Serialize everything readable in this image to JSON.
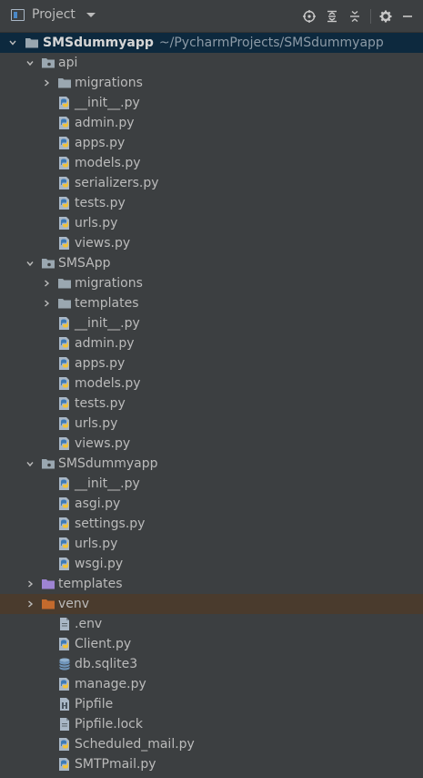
{
  "header": {
    "title": "Project"
  },
  "root": {
    "name": "SMSdummyapp",
    "path": "~/PycharmProjects/SMSdummyapp"
  },
  "tree": [
    {
      "name": "api",
      "depth": 1,
      "kind": "pkg",
      "expanded": true
    },
    {
      "name": "migrations",
      "depth": 2,
      "kind": "folder",
      "expanded": false
    },
    {
      "name": "__init__.py",
      "depth": 3,
      "kind": "py"
    },
    {
      "name": "admin.py",
      "depth": 3,
      "kind": "py"
    },
    {
      "name": "apps.py",
      "depth": 3,
      "kind": "py"
    },
    {
      "name": "models.py",
      "depth": 3,
      "kind": "py"
    },
    {
      "name": "serializers.py",
      "depth": 3,
      "kind": "py"
    },
    {
      "name": "tests.py",
      "depth": 3,
      "kind": "py"
    },
    {
      "name": "urls.py",
      "depth": 3,
      "kind": "py"
    },
    {
      "name": "views.py",
      "depth": 3,
      "kind": "py"
    },
    {
      "name": "SMSApp",
      "depth": 1,
      "kind": "pkg",
      "expanded": true
    },
    {
      "name": "migrations",
      "depth": 2,
      "kind": "folder",
      "expanded": false
    },
    {
      "name": "templates",
      "depth": 2,
      "kind": "folder",
      "expanded": false
    },
    {
      "name": "__init__.py",
      "depth": 3,
      "kind": "py"
    },
    {
      "name": "admin.py",
      "depth": 3,
      "kind": "py"
    },
    {
      "name": "apps.py",
      "depth": 3,
      "kind": "py"
    },
    {
      "name": "models.py",
      "depth": 3,
      "kind": "py"
    },
    {
      "name": "tests.py",
      "depth": 3,
      "kind": "py"
    },
    {
      "name": "urls.py",
      "depth": 3,
      "kind": "py"
    },
    {
      "name": "views.py",
      "depth": 3,
      "kind": "py"
    },
    {
      "name": "SMSdummyapp",
      "depth": 1,
      "kind": "pkg",
      "expanded": true
    },
    {
      "name": "__init__.py",
      "depth": 3,
      "kind": "py"
    },
    {
      "name": "asgi.py",
      "depth": 3,
      "kind": "py"
    },
    {
      "name": "settings.py",
      "depth": 3,
      "kind": "py"
    },
    {
      "name": "urls.py",
      "depth": 3,
      "kind": "py"
    },
    {
      "name": "wsgi.py",
      "depth": 3,
      "kind": "py"
    },
    {
      "name": "templates",
      "depth": 1,
      "kind": "templates",
      "expanded": false
    },
    {
      "name": "venv",
      "depth": 1,
      "kind": "venv",
      "expanded": false
    },
    {
      "name": ".env",
      "depth": 2,
      "kind": "file"
    },
    {
      "name": "Client.py",
      "depth": 2,
      "kind": "py"
    },
    {
      "name": "db.sqlite3",
      "depth": 2,
      "kind": "db"
    },
    {
      "name": "manage.py",
      "depth": 2,
      "kind": "py"
    },
    {
      "name": "Pipfile",
      "depth": 2,
      "kind": "pipfile"
    },
    {
      "name": "Pipfile.lock",
      "depth": 2,
      "kind": "file"
    },
    {
      "name": "Scheduled_mail.py",
      "depth": 2,
      "kind": "py"
    },
    {
      "name": "SMTPmail.py",
      "depth": 2,
      "kind": "py"
    }
  ],
  "colors": {
    "background": "#3c3f41",
    "selected_row": "#0d293e",
    "venv_row": "#4a3b2d",
    "text": "#bbbbbb",
    "path_text": "#8c9aa6"
  },
  "toolbar": {
    "icons": [
      "locate-icon",
      "expand-all-icon",
      "collapse-all-icon",
      "gear-icon",
      "hide-icon"
    ]
  }
}
